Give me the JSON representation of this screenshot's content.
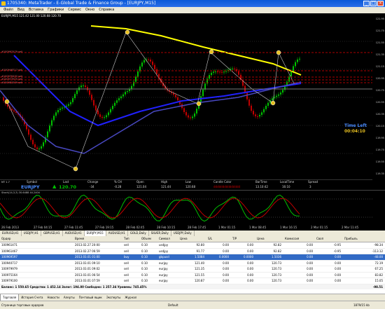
{
  "window": {
    "title": "1705340: MetaTrader - E-Global Trade & Finance Group - [EURJPY,M15]"
  },
  "menu": [
    "Файл",
    "Вид",
    "Вставка",
    "Графики",
    "Сервис",
    "Окно",
    "Справка"
  ],
  "chart": {
    "header": "EURJPY,M15  121.42  121.00  120.68  120.70",
    "timeleft_label": "Time Left",
    "timeleft_value": "00:04:10",
    "price_axis": [
      "121.95",
      "121.75",
      "121.55",
      "121.35",
      "121.15",
      "120.95",
      "120.75",
      "120.55",
      "120.35",
      "120.15",
      "119.95",
      "119.75",
      "119.55",
      "119.35"
    ],
    "order_tags": [
      "#100997479 sell",
      "#100946717 sell",
      "#100979432 sell",
      "#100977975 sell",
      "#100981509 sell"
    ],
    "infobar": {
      "mt": "MT 1.7",
      "label_symbol": "Symbol",
      "label_last": "Last",
      "label_change": "Change",
      "label_pct": "% CH",
      "label_open": "Open",
      "label_high": "High",
      "label_low": "Low",
      "label_candle": "Candle Color",
      "label_bartime": "BarTime",
      "label_local": "LocalTime",
      "label_spread": "Spread",
      "symbol": "EURJPY",
      "last": "120.70",
      "change": "-34",
      "pct": "-0.28",
      "open": "121.04",
      "high": "121.44",
      "low": "120.68",
      "candle": "ddddddddddddddd",
      "bartime": "13.10:42",
      "local": "16:10",
      "spread": "3"
    },
    "colors": {
      "bg": "#000000",
      "up": "#00c000",
      "down": "#c00000",
      "ma_yellow": "#ffff00",
      "ma_blue": "#2020ff",
      "ma_navy": "#3030a0"
    }
  },
  "stoch": {
    "label": "Stoch(14,3,3) 30.6488 44.2404"
  },
  "time_axis": [
    "26 Feb 2013",
    "27 Feb 04:15",
    "27 Feb 11:45",
    "27 Feb 19:15",
    "28 Feb 02:45",
    "28 Feb 10:15",
    "28 Feb 17:45",
    "1 Mar 01:15",
    "1 Mar 08:45",
    "1 Mar 16:15",
    "2 Mar 01:15",
    "2 Mar 11:45"
  ],
  "chart_tabs": [
    "EURUSD,H1",
    "USDJPY,H1",
    "GBPUSD,H1",
    "AUDUSD,H1",
    "EURJPY,M15",
    "AUDUSD,H1",
    "GOLD,Daily",
    "SILVER,Daily",
    "USDJPY,Daily"
  ],
  "terminal": {
    "columns": [
      "Ордер",
      "Время",
      "Тип",
      "Объем",
      "Символ",
      "Цена",
      "S/L",
      "T/P",
      "Цена",
      "Комиссия",
      "Своп",
      "Прибыль"
    ],
    "rows": [
      [
        "100961471",
        "2013.02.27 20:00",
        "sell",
        "0.10",
        "usdjpy",
        "92.80",
        "0.00",
        "0.00",
        "92.82",
        "0.00",
        "-0.95",
        "-98.34"
      ],
      [
        "100961467",
        "2013.02.27 06:59",
        "sell",
        "0.10",
        "usdjpy",
        "91.77",
        "0.00",
        "0.00",
        "92.82",
        "0.00",
        "-0.95",
        "-113.12"
      ],
      [
        "100969597",
        "2013.03.01 01:00",
        "buy",
        "0.10",
        "gbpusd",
        "1.5084",
        "0.0000",
        "0.0000",
        "1.5036",
        "0.00",
        "0.00",
        "-48.00"
      ],
      [
        "100940717",
        "2013.03.01 09:10",
        "sell",
        "0.10",
        "eurjpy",
        "121.40",
        "0.00",
        "0.00",
        "120.73",
        "0.00",
        "0.00",
        "72.19"
      ],
      [
        "100979979",
        "2013.03.01 09:02",
        "sell",
        "0.10",
        "eurjpy",
        "121.35",
        "0.00",
        "0.00",
        "120.73",
        "0.00",
        "0.00",
        "67.25"
      ],
      [
        "100975164",
        "2013.03.01 06:54",
        "sell",
        "0.10",
        "eurjpy",
        "121.55",
        "0.00",
        "0.00",
        "120.73",
        "0.00",
        "0.00",
        "83.82"
      ],
      [
        "100979100",
        "2013.03.01 07:59",
        "sell",
        "0.10",
        "eurjpy",
        "120.87",
        "0.00",
        "0.00",
        "120.73",
        "0.00",
        "0.00",
        "15.05"
      ]
    ],
    "balance": "Баланс: 1 550.65  Средства: 1 452.14  Залог: 194.80  Свободно: 1 257.34  Уровень: 745.45%",
    "balance_profit": "-98.51"
  },
  "bottom_tabs": [
    "Торговля",
    "История Счета",
    "Новости",
    "Алерты",
    "Почтовый ящик",
    "Эксперты",
    "Журнал"
  ],
  "status": {
    "left": "Страница торговых ордеров",
    "mid": "Default",
    "right": "1879/15 kb"
  }
}
